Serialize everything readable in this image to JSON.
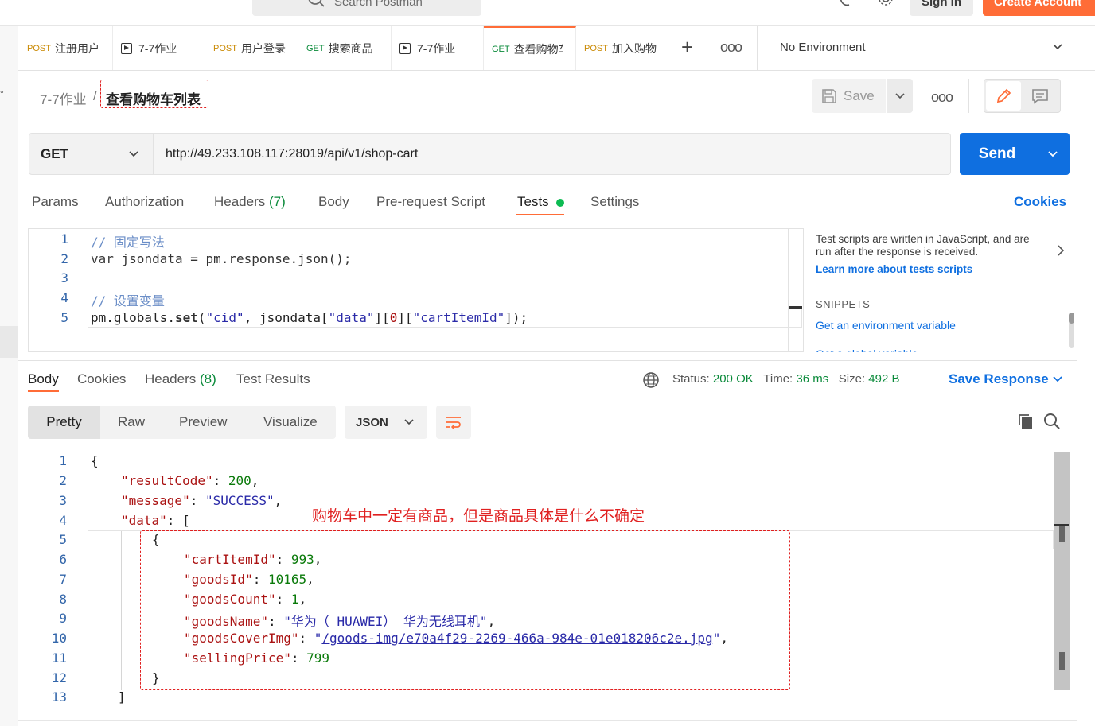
{
  "top": {
    "search_placeholder": "Search Postman",
    "sign_in": "Sign In",
    "create_account": "Create Account"
  },
  "tabs": [
    {
      "method": "POST",
      "label": "注册用户",
      "type": "request"
    },
    {
      "method": "",
      "label": "7-7作业",
      "type": "runner"
    },
    {
      "method": "POST",
      "label": "用户登录",
      "type": "request"
    },
    {
      "method": "GET",
      "label": "搜索商品",
      "type": "request"
    },
    {
      "method": "",
      "label": "7-7作业",
      "type": "runner"
    },
    {
      "method": "GET",
      "label": "查看购物车",
      "type": "request",
      "active": true
    },
    {
      "method": "POST",
      "label": "加入购物车",
      "type": "request"
    }
  ],
  "environment": {
    "label": "No Environment"
  },
  "breadcrumb": {
    "parent": "7-7作业",
    "separator": "/",
    "current": "查看购物车列表"
  },
  "toolbar": {
    "save_label": "Save"
  },
  "request": {
    "method": "GET",
    "url": "http://49.233.108.117:28019/api/v1/shop-cart",
    "send_label": "Send"
  },
  "request_tabs": {
    "params": "Params",
    "authorization": "Authorization",
    "headers": "Headers",
    "headers_count": "(7)",
    "body": "Body",
    "pre_request": "Pre-request Script",
    "tests": "Tests",
    "settings": "Settings",
    "cookies": "Cookies"
  },
  "script": {
    "line_numbers": [
      "1",
      "2",
      "3",
      "4",
      "5"
    ],
    "line1": "// 固定写法",
    "line2_kw": "var",
    "line2_rest": " jsondata = pm.response.json();",
    "line4": "// 设置变量",
    "line5_a": "pm.globals.",
    "line5_fn": "set",
    "line5_b": "(",
    "line5_s1": "\"cid\"",
    "line5_c": ", jsondata[",
    "line5_s2": "\"data\"",
    "line5_d": "][",
    "line5_n": "0",
    "line5_e": "][",
    "line5_s3": "\"cartItemId\"",
    "line5_f": "]);"
  },
  "side_panel": {
    "description": "Test scripts are written in JavaScript, and are run after the response is received.",
    "learn_more": "Learn more about tests scripts",
    "snippets_heading": "SNIPPETS",
    "snippet_1": "Get an environment variable",
    "snippet_2": "Get a global variable"
  },
  "response_tabs": {
    "body": "Body",
    "cookies": "Cookies",
    "headers": "Headers",
    "headers_count": "(8)",
    "test_results": "Test Results"
  },
  "response_meta": {
    "status_label": "Status:",
    "status_value": "200 OK",
    "time_label": "Time:",
    "time_value": "36 ms",
    "size_label": "Size:",
    "size_value": "492 B",
    "save_response": "Save Response"
  },
  "view_options": {
    "pretty": "Pretty",
    "raw": "Raw",
    "preview": "Preview",
    "visualize": "Visualize",
    "format": "JSON"
  },
  "response_body": {
    "line_numbers": [
      "1",
      "2",
      "3",
      "4",
      "5",
      "6",
      "7",
      "8",
      "9",
      "10",
      "11",
      "12",
      "13"
    ],
    "open_brace": "{",
    "k_resultCode": "\"resultCode\"",
    "v_resultCode": "200",
    "k_message": "\"message\"",
    "v_message": "\"SUCCESS\"",
    "k_data": "\"data\"",
    "open_bracket": "[",
    "obj_open": "{",
    "k_cartItemId": "\"cartItemId\"",
    "v_cartItemId": "993",
    "k_goodsId": "\"goodsId\"",
    "v_goodsId": "10165",
    "k_goodsCount": "\"goodsCount\"",
    "v_goodsCount": "1",
    "k_goodsName": "\"goodsName\"",
    "v_goodsName": "\"华为（ HUAWEI） 华为无线耳机\"",
    "k_goodsCoverImg": "\"goodsCoverImg\"",
    "v_goodsCoverImg_q1": "\"",
    "v_goodsCoverImg_link": "/goods-img/e70a4f29-2269-466a-984e-01e018206c2e.jpg",
    "v_goodsCoverImg_q2": "\"",
    "k_sellingPrice": "\"sellingPrice\"",
    "v_sellingPrice": "799",
    "obj_close": "}",
    "close_bracket": "]"
  },
  "annotation": {
    "note": "购物车中一定有商品，但是商品具体是什么不确定"
  },
  "colors": {
    "accent": "#ff6c37",
    "primary": "#0f6fe0",
    "success": "#0a8a3a",
    "annotation": "#e02020"
  }
}
